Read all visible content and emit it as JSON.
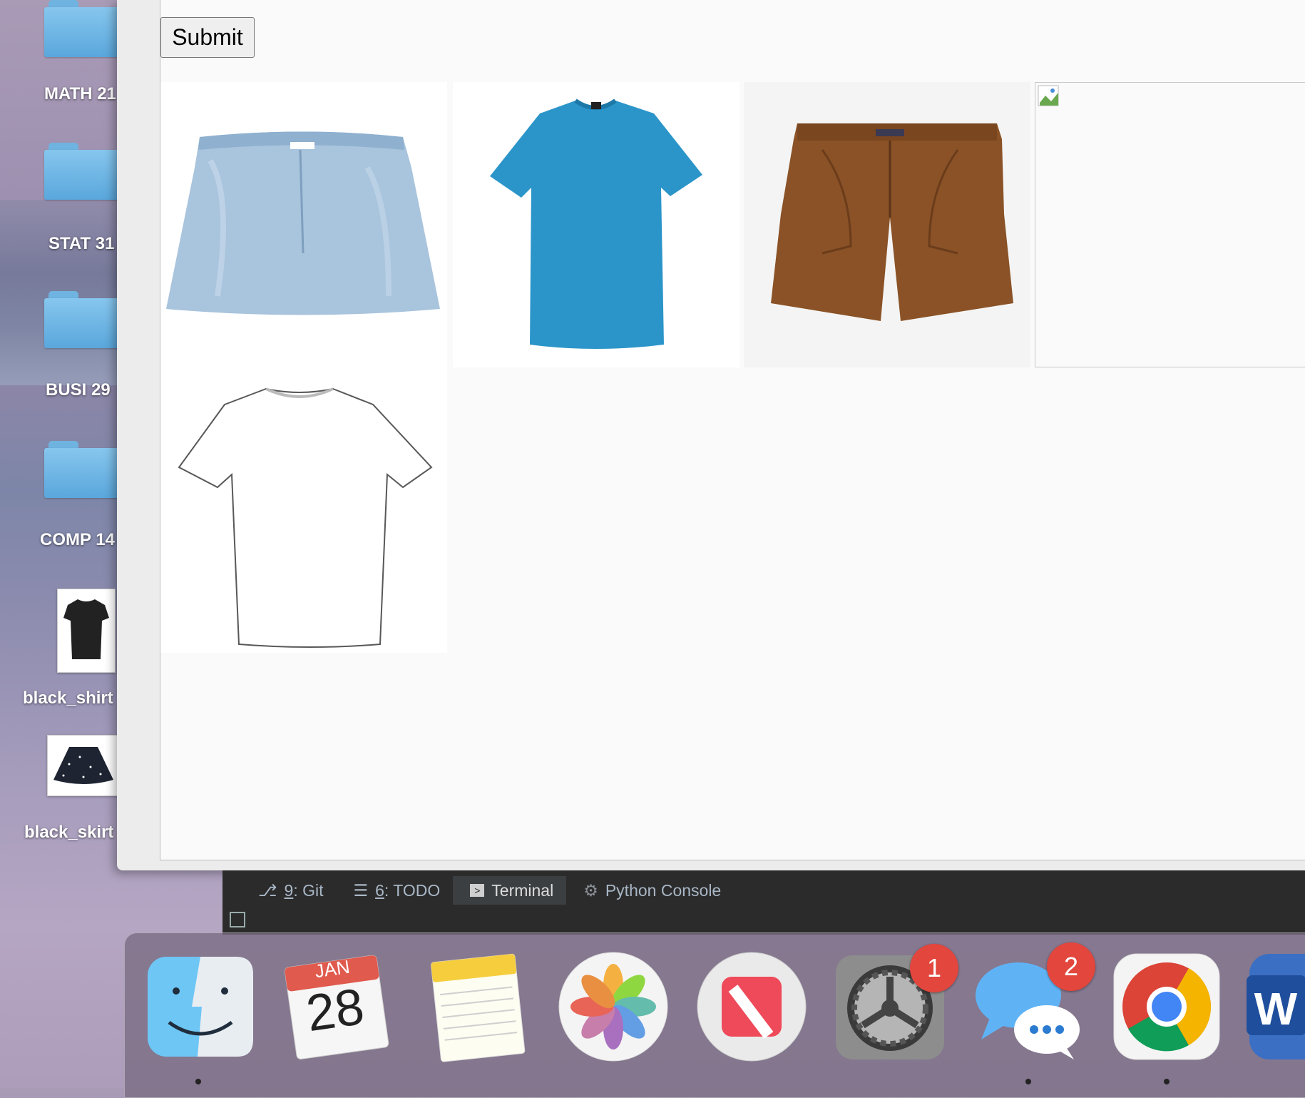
{
  "desktop": {
    "items": [
      {
        "label": "MATH 21",
        "type": "folder"
      },
      {
        "label": "STAT 31",
        "type": "folder"
      },
      {
        "label": "BUSI 29",
        "type": "folder"
      },
      {
        "label": "COMP 14",
        "type": "folder"
      },
      {
        "label": "black_shirt",
        "type": "image"
      },
      {
        "label": "black_skirt",
        "type": "image"
      }
    ]
  },
  "page": {
    "submit_label": "Submit",
    "products": [
      {
        "item": "denim-skirt",
        "color": "#a9c4dd"
      },
      {
        "item": "blue-t-shirt",
        "color": "#2b95c9"
      },
      {
        "item": "brown-shorts",
        "color": "#8a5226"
      },
      {
        "item": "broken-image",
        "color": "#ffffff"
      },
      {
        "item": "white-t-shirt",
        "color": "#ffffff"
      }
    ]
  },
  "ide": {
    "tabs": [
      {
        "num": "9",
        "text": ": Git",
        "icon": "git-branch-icon"
      },
      {
        "num": "6",
        "text": ": TODO",
        "icon": "list-icon"
      },
      {
        "num": "",
        "text": "Terminal",
        "icon": "terminal-icon",
        "active": true
      },
      {
        "num": "",
        "text": "Python Console",
        "icon": "python-icon"
      }
    ]
  },
  "dock": {
    "calendar_month": "JAN",
    "calendar_day": "28",
    "system_prefs_badge": "1",
    "messages_badge": "2",
    "word_letter": "W"
  }
}
